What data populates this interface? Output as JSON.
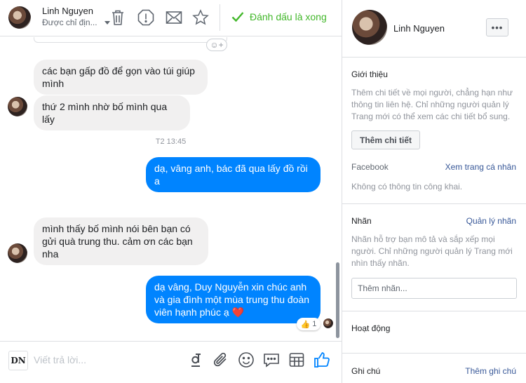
{
  "header": {
    "contact_name": "Linh Nguyen",
    "assign_label": "Được chỉ địn...",
    "done_label": "Đánh dấu là xong"
  },
  "thread": {
    "messages": [
      {
        "direction": "in",
        "lines": [
          "các bạn gấp đồ để gọn vào túi giúp",
          "mình"
        ]
      },
      {
        "direction": "in",
        "lines": [
          "thứ 2 mình nhờ bố mình qua lấy"
        ]
      },
      {
        "direction": "out",
        "lines": [
          "dạ, vâng anh, bác đã qua lấy đồ rồi",
          "a"
        ]
      },
      {
        "direction": "in",
        "lines": [
          "mình thấy bố mình nói bên bạn có",
          "gửi quà trung thu. cảm ơn các bạn",
          "nha"
        ]
      },
      {
        "direction": "out",
        "lines": [
          "dạ vâng, Duy Nguyễn xin chúc anh",
          "và gia đình một mùa trung thu đoàn",
          "viên hạnh phúc ạ ❤️"
        ]
      }
    ],
    "timestamp": "T2 13:45",
    "reaction": {
      "emoji": "👍",
      "count": "1"
    }
  },
  "composer": {
    "placeholder": "Viết trả lời...",
    "logo_text": "DN"
  },
  "profile": {
    "name": "Linh Nguyen",
    "more_label": "•••"
  },
  "intro": {
    "title": "Giới thiệu",
    "text": "Thêm chi tiết về mọi người, chẳng hạn như thông tin liên hệ. Chỉ những người quản lý Trang mới có thể xem các chi tiết bổ sung.",
    "button": "Thêm chi tiết",
    "facebook_label": "Facebook",
    "facebook_link": "Xem trang cá nhân",
    "no_public": "Không có thông tin công khai."
  },
  "tags": {
    "title": "Nhãn",
    "manage_link": "Quản lý nhãn",
    "text": "Nhãn hỗ trợ bạn mô tả và sắp xếp mọi người. Chỉ những người quản lý Trang mới nhìn thấy nhãn.",
    "input_placeholder": "Thêm nhãn..."
  },
  "activity": {
    "title": "Hoạt động"
  },
  "notes": {
    "title": "Ghi chú",
    "add_link": "Thêm ghi chú"
  },
  "colors": {
    "accent_blue": "#0084ff",
    "done_green": "#42b72a",
    "link_blue": "#385898"
  }
}
